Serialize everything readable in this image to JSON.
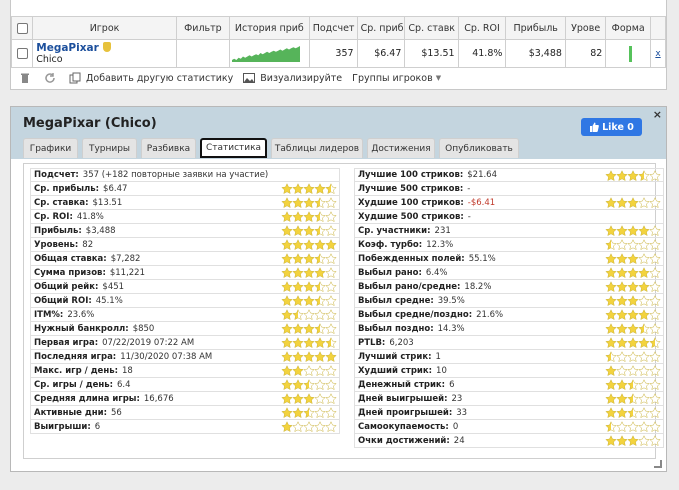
{
  "table": {
    "headers": [
      "Игрок",
      "Фильтр",
      "История приб",
      "Подсчет",
      "Ср. приб",
      "Ср. ставк",
      "Ср. ROI",
      "Прибыль",
      "Урове",
      "Форма"
    ],
    "row": {
      "name": "MegaPixar",
      "room": "Chico",
      "count": "357",
      "avg_profit": "$6.47",
      "avg_stake": "$13.51",
      "avg_roi": "41.8%",
      "profit": "$3,488",
      "level": "82",
      "remove": "x"
    },
    "sparkline": [
      2,
      3,
      2,
      4,
      3,
      5,
      4,
      5,
      6,
      5,
      6,
      7,
      6,
      8,
      7,
      8,
      9,
      8,
      9,
      10,
      9,
      10,
      11,
      10,
      11,
      12,
      11,
      12,
      13,
      12,
      13,
      14
    ]
  },
  "toolbar": {
    "add_label": "Добавить другую статистику",
    "visualize_label": "Визуализируйте",
    "groups_label": "Группы игроков"
  },
  "dialog": {
    "title": "MegaPixar (Chico)",
    "like_label": "Like 0",
    "close": "×",
    "tabs": [
      "Графики",
      "Турниры",
      "Разбивка",
      "Статистика",
      "Таблицы лидеров",
      "Достижения",
      "Опубликовать"
    ],
    "active_tab": 3
  },
  "stats_left": [
    {
      "label": "Подсчет:",
      "value": "357 (+182 повторные заявки на участие)",
      "stars": null
    },
    {
      "label": "Ср. прибыль:",
      "value": "$6.47",
      "stars": 4.5
    },
    {
      "label": "Ср. ставка:",
      "value": "$13.51",
      "stars": 3.5
    },
    {
      "label": "Ср. ROI:",
      "value": "41.8%",
      "stars": 3.5
    },
    {
      "label": "Прибыль:",
      "value": "$3,488",
      "stars": 3.5
    },
    {
      "label": "Уровень:",
      "value": "82",
      "stars": 5
    },
    {
      "label": "Общая ставка:",
      "value": "$7,282",
      "stars": 3.5
    },
    {
      "label": "Сумма призов:",
      "value": "$11,221",
      "stars": 4
    },
    {
      "label": "Общий рейк:",
      "value": "$451",
      "stars": 3.5
    },
    {
      "label": "Общий ROI:",
      "value": "45.1%",
      "stars": 3.5
    },
    {
      "label": "ITM%:",
      "value": "23.6%",
      "stars": 1.5
    },
    {
      "label": "Нужный банкролл:",
      "value": "$850",
      "stars": 3.5
    },
    {
      "label": "Первая игра:",
      "value": "07/22/2019 07:22 AM",
      "stars": 4.5
    },
    {
      "label": "Последняя игра:",
      "value": "11/30/2020 07:38 AM",
      "stars": 5
    },
    {
      "label": "Макс. игр / день:",
      "value": "18",
      "stars": 2
    },
    {
      "label": "Ср. игры / день:",
      "value": "6.4",
      "stars": 2.5
    },
    {
      "label": "Средняя длина игры:",
      "value": "16,676",
      "stars": 3
    },
    {
      "label": "Активные дни:",
      "value": "56",
      "stars": 2.5
    },
    {
      "label": "Выигрыши:",
      "value": "6",
      "stars": 1
    }
  ],
  "stats_right": [
    {
      "label": "Лучшие 100 стриков:",
      "value": "$21.64",
      "stars": 3.5,
      "neg": false
    },
    {
      "label": "Лучшие 500 стриков:",
      "value": "-",
      "stars": null,
      "neg": false
    },
    {
      "label": "Худшие 100 стриков:",
      "value": "-$6.41",
      "stars": 3,
      "neg": true
    },
    {
      "label": "Худшие 500 стриков:",
      "value": "-",
      "stars": null,
      "neg": false
    },
    {
      "label": "Ср. участники:",
      "value": "231",
      "stars": 4,
      "neg": false
    },
    {
      "label": "Коэф. турбо:",
      "value": "12.3%",
      "stars": 0.5,
      "neg": false
    },
    {
      "label": "Побежденных полей:",
      "value": "55.1%",
      "stars": 3,
      "neg": false
    },
    {
      "label": "Выбыл рано:",
      "value": "6.4%",
      "stars": 4,
      "neg": false
    },
    {
      "label": "Выбыл рано/средне:",
      "value": "18.2%",
      "stars": 4,
      "neg": false
    },
    {
      "label": "Выбыл средне:",
      "value": "39.5%",
      "stars": 3,
      "neg": false
    },
    {
      "label": "Выбыл средне/поздно:",
      "value": "21.6%",
      "stars": 4,
      "neg": false
    },
    {
      "label": "Выбыл поздно:",
      "value": "14.3%",
      "stars": 3.5,
      "neg": false
    },
    {
      "label": "PTLB:",
      "value": "6,203",
      "stars": 4.5,
      "neg": false
    },
    {
      "label": "Лучший стрик:",
      "value": "1",
      "stars": 0.5,
      "neg": false
    },
    {
      "label": "Худший стрик:",
      "value": "10",
      "stars": 1,
      "neg": false
    },
    {
      "label": "Денежный стрик:",
      "value": "6",
      "stars": 2.5,
      "neg": false
    },
    {
      "label": "Дней выигрышей:",
      "value": "23",
      "stars": 2.5,
      "neg": false
    },
    {
      "label": "Дней проигрышей:",
      "value": "33",
      "stars": 2.5,
      "neg": false
    },
    {
      "label": "Самоокупаемость:",
      "value": "0",
      "stars": 0.5,
      "neg": false
    },
    {
      "label": "Очки достижений:",
      "value": "24",
      "stars": 3,
      "neg": false
    }
  ],
  "colors": {
    "star_fill": "#f3d33e",
    "star_empty": "#ffffff",
    "link": "#1c4f9c",
    "like_button": "#2f77e4",
    "header_band": "#c4d5df",
    "sparkline": "#56b45a"
  }
}
